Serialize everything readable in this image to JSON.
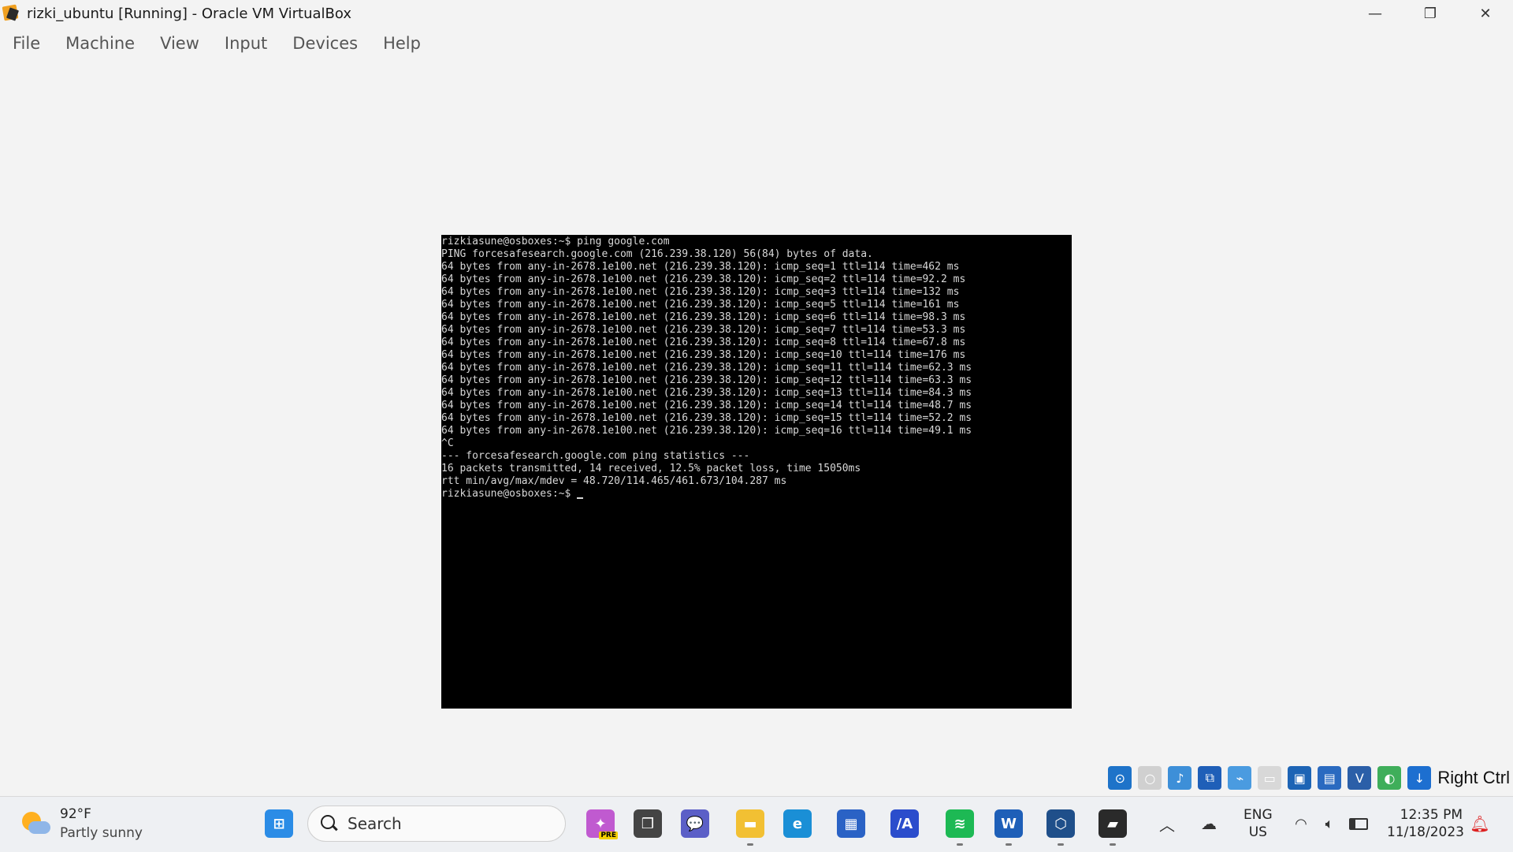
{
  "window": {
    "title": "rizki_ubuntu [Running] - Oracle VM VirtualBox",
    "controls": {
      "minimize": "—",
      "restore": "❐",
      "close": "✕"
    }
  },
  "menu": [
    "File",
    "Machine",
    "View",
    "Input",
    "Devices",
    "Help"
  ],
  "terminal": {
    "lines": [
      "rizkiasune@osboxes:~$ ping google.com",
      "PING forcesafesearch.google.com (216.239.38.120) 56(84) bytes of data.",
      "64 bytes from any-in-2678.1e100.net (216.239.38.120): icmp_seq=1 ttl=114 time=462 ms",
      "64 bytes from any-in-2678.1e100.net (216.239.38.120): icmp_seq=2 ttl=114 time=92.2 ms",
      "64 bytes from any-in-2678.1e100.net (216.239.38.120): icmp_seq=3 ttl=114 time=132 ms",
      "64 bytes from any-in-2678.1e100.net (216.239.38.120): icmp_seq=5 ttl=114 time=161 ms",
      "64 bytes from any-in-2678.1e100.net (216.239.38.120): icmp_seq=6 ttl=114 time=98.3 ms",
      "64 bytes from any-in-2678.1e100.net (216.239.38.120): icmp_seq=7 ttl=114 time=53.3 ms",
      "64 bytes from any-in-2678.1e100.net (216.239.38.120): icmp_seq=8 ttl=114 time=67.8 ms",
      "64 bytes from any-in-2678.1e100.net (216.239.38.120): icmp_seq=10 ttl=114 time=176 ms",
      "64 bytes from any-in-2678.1e100.net (216.239.38.120): icmp_seq=11 ttl=114 time=62.3 ms",
      "64 bytes from any-in-2678.1e100.net (216.239.38.120): icmp_seq=12 ttl=114 time=63.3 ms",
      "64 bytes from any-in-2678.1e100.net (216.239.38.120): icmp_seq=13 ttl=114 time=84.3 ms",
      "64 bytes from any-in-2678.1e100.net (216.239.38.120): icmp_seq=14 ttl=114 time=48.7 ms",
      "64 bytes from any-in-2678.1e100.net (216.239.38.120): icmp_seq=15 ttl=114 time=52.2 ms",
      "64 bytes from any-in-2678.1e100.net (216.239.38.120): icmp_seq=16 ttl=114 time=49.1 ms",
      "^C",
      "--- forcesafesearch.google.com ping statistics ---",
      "16 packets transmitted, 14 received, 12.5% packet loss, time 15050ms",
      "rtt min/avg/max/mdev = 48.720/114.465/461.673/104.287 ms"
    ],
    "prompt": "rizkiasune@osboxes:~$ "
  },
  "vbox_status": {
    "icons": [
      {
        "name": "hard-disk-icon",
        "color": "#1e73c9",
        "glyph": "⊙"
      },
      {
        "name": "optical-drive-icon",
        "color": "#d0d0d0",
        "glyph": "○"
      },
      {
        "name": "audio-icon",
        "color": "#3d8fd8",
        "glyph": "♪"
      },
      {
        "name": "network-icon",
        "color": "#1f5fb8",
        "glyph": "⧉"
      },
      {
        "name": "usb-icon",
        "color": "#4a9be0",
        "glyph": "⌁"
      },
      {
        "name": "shared-folders-icon",
        "color": "#d8d8d8",
        "glyph": "▭"
      },
      {
        "name": "display-icon",
        "color": "#1d64b5",
        "glyph": "▣"
      },
      {
        "name": "recording-icon",
        "color": "#2a6ac0",
        "glyph": "▤"
      },
      {
        "name": "vt-x-icon",
        "color": "#2b5fa8",
        "glyph": "V"
      },
      {
        "name": "guest-additions-icon",
        "color": "#3fae5a",
        "glyph": "◐"
      },
      {
        "name": "mouse-integration-icon",
        "color": "#1d6fd0",
        "glyph": "↓"
      }
    ],
    "host_key": "Right Ctrl"
  },
  "taskbar": {
    "weather": {
      "temp": "92°F",
      "desc": "Partly sunny"
    },
    "search_placeholder": "Search",
    "apps": [
      {
        "name": "windows-start-icon",
        "color": "#2b8ce6",
        "glyph": "⊞"
      },
      {
        "name": "copilot-icon",
        "color": "#c05ad0",
        "glyph": "✦",
        "badge": "PRE"
      },
      {
        "name": "task-view-icon",
        "color": "#444444",
        "glyph": "❒"
      },
      {
        "name": "chat-icon",
        "color": "#5b5fc7",
        "glyph": "💬"
      },
      {
        "name": "file-explorer-icon",
        "color": "#f2c033",
        "glyph": "▬"
      },
      {
        "name": "edge-icon",
        "color": "#1a8fd6",
        "glyph": "e"
      },
      {
        "name": "store-icon",
        "color": "#2a62c5",
        "glyph": "▦"
      },
      {
        "name": "adobe-app-icon",
        "color": "#2b4dcc",
        "glyph": "/A"
      },
      {
        "name": "spotify-icon",
        "color": "#1db954",
        "glyph": "≋"
      },
      {
        "name": "word-icon",
        "color": "#1e5fb8",
        "glyph": "W"
      },
      {
        "name": "virtualbox-icon",
        "color": "#1f4f8a",
        "glyph": "⬡"
      },
      {
        "name": "virtualbox-vm-icon",
        "color": "#2a2a2a",
        "glyph": "▰"
      }
    ],
    "tray": {
      "lang": "ENG",
      "region": "US",
      "time": "12:35 PM",
      "date": "11/18/2023"
    }
  }
}
